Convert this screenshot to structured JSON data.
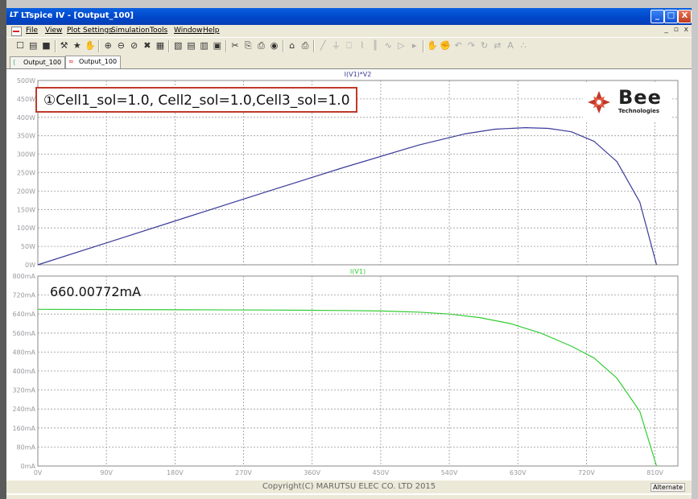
{
  "window": {
    "title": "LTspice IV - [Output_100]",
    "app_logo": "LT",
    "minimize": "_",
    "maximize": "□",
    "close": "X",
    "mdi_controls": "_ ▫ x"
  },
  "menu": {
    "items": [
      "File",
      "View",
      "Plot Settings",
      "Simulation",
      "Tools",
      "Window",
      "Help"
    ]
  },
  "toolbar": {
    "icons": [
      "new-schematic-icon",
      "open-icon",
      "save-icon",
      "control-panel-icon",
      "run-icon",
      "halt-icon",
      "zoom-in-icon",
      "zoom-out-icon",
      "zoom-full-icon",
      "zoom-cancel-icon",
      "autorange-icon",
      "add-trace-icon",
      "tile-horizontal-icon",
      "tile-vertical-icon",
      "cascade-icon",
      "cut-icon",
      "copy-icon",
      "paste-icon",
      "find-icon",
      "print-setup-icon",
      "print-icon",
      "wire-icon",
      "ground-icon",
      "label-icon",
      "resistor-icon",
      "capacitor-icon",
      "inductor-icon",
      "diode-icon",
      "component-icon",
      "move-icon",
      "drag-icon",
      "undo-icon",
      "redo-icon",
      "rotate-icon",
      "mirror-icon",
      "text-icon",
      "spice-directive-icon"
    ]
  },
  "tabs": [
    {
      "label": "Output_100",
      "icon": "schematic-icon",
      "active": false
    },
    {
      "label": "Output_100",
      "icon": "waveform-icon",
      "active": true
    }
  ],
  "annotation": "①Cell1_sol=1.0, Cell2_sol=1.0,Cell3_sol=1.0",
  "readout": "660.00772mA",
  "logo": {
    "brand": "Bee",
    "sub": "Technologies",
    "color": "#c0392b"
  },
  "status": {
    "copyright": "Copyright(C) MARUTSU ELEC CO. LTD 2015",
    "alternate": "Alternate"
  },
  "chart_data": [
    {
      "type": "line",
      "title": "I(V1)*V2",
      "x": [
        0,
        100,
        200,
        300,
        400,
        500,
        560,
        600,
        640,
        670,
        700,
        730,
        760,
        790,
        812
      ],
      "series": [
        {
          "name": "I(V1)*V2",
          "color": "#3a3a9a",
          "values": [
            0,
            66,
            132,
            198,
            263,
            325,
            355,
            368,
            372,
            370,
            361,
            335,
            280,
            170,
            0
          ]
        }
      ],
      "xlim": [
        0,
        840
      ],
      "ylim": [
        0,
        500
      ],
      "yticks": [
        "0W",
        "50W",
        "100W",
        "150W",
        "200W",
        "250W",
        "300W",
        "350W",
        "400W",
        "450W",
        "500W"
      ],
      "grid": true
    },
    {
      "type": "line",
      "title": "I(V1)",
      "x": [
        0,
        100,
        200,
        300,
        400,
        450,
        500,
        540,
        580,
        620,
        660,
        700,
        730,
        760,
        790,
        812
      ],
      "series": [
        {
          "name": "I(V1)",
          "color": "#33cc33",
          "values": [
            660,
            659,
            658,
            657,
            655,
            653,
            648,
            640,
            625,
            600,
            560,
            505,
            455,
            370,
            230,
            0
          ]
        }
      ],
      "xlim": [
        0,
        840
      ],
      "ylim": [
        0,
        800
      ],
      "yticks": [
        "0mA",
        "80mA",
        "160mA",
        "240mA",
        "320mA",
        "400mA",
        "480mA",
        "560mA",
        "640mA",
        "720mA",
        "800mA"
      ],
      "xticks": [
        "0V",
        "90V",
        "180V",
        "270V",
        "360V",
        "450V",
        "540V",
        "630V",
        "720V",
        "810V"
      ],
      "grid": true
    }
  ]
}
